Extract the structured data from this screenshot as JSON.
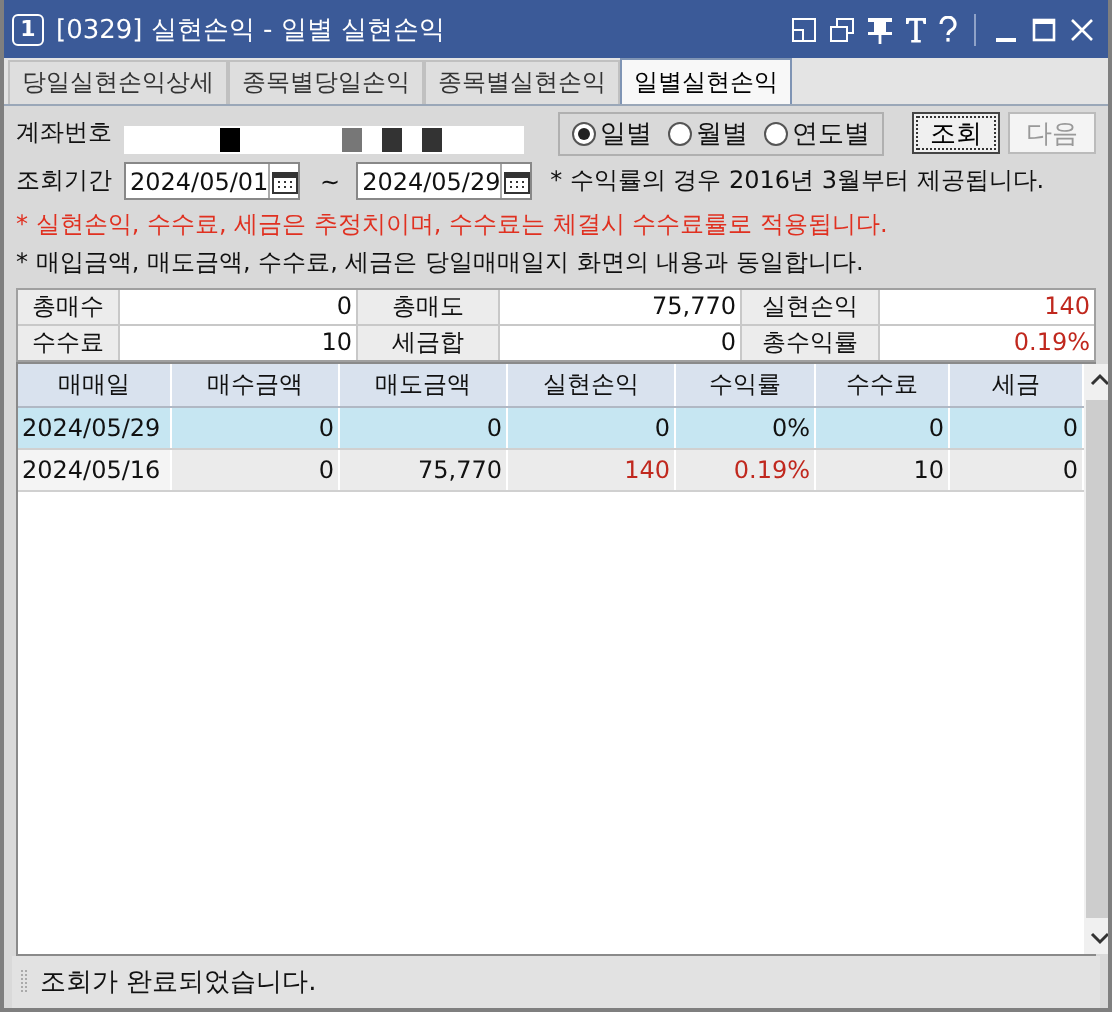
{
  "window": {
    "number": "1",
    "title": "[0329] 실현손익 - 일별 실현손익"
  },
  "tabs": [
    {
      "label": "당일실현손익상세",
      "selected": false
    },
    {
      "label": "종목별당일손익",
      "selected": false
    },
    {
      "label": "종목별실현손익",
      "selected": false
    },
    {
      "label": "일별실현손익",
      "selected": true
    }
  ],
  "account": {
    "label": "계좌번호"
  },
  "periods": [
    {
      "label": "일별",
      "selected": true
    },
    {
      "label": "월별",
      "selected": false
    },
    {
      "label": "연도별",
      "selected": false
    }
  ],
  "buttons": [
    {
      "label": "조회",
      "disabled": false
    },
    {
      "label": "다음",
      "disabled": true
    }
  ],
  "range": {
    "label": "조회기간",
    "from": "2024/05/01",
    "separator": "~",
    "to": "2024/05/29",
    "note": "* 수익률의 경우 2016년 3월부터 제공됩니다."
  },
  "notices": [
    {
      "text": "* 실현손익, 수수료, 세금은 추정치이며, 수수료는 체결시 수수료률로 적용됩니다.",
      "warning": true
    },
    {
      "text": "* 매입금액, 매도금액, 수수료, 세금은 당일매매일지 화면의 내용과 동일합니다.",
      "warning": false
    }
  ],
  "summary": [
    [
      {
        "label": "총매수",
        "value": "0",
        "up": false
      },
      {
        "label": "총매도",
        "value": "75,770",
        "up": false
      },
      {
        "label": "실현손익",
        "value": "140",
        "up": true
      }
    ],
    [
      {
        "label": "수수료",
        "value": "10",
        "up": false
      },
      {
        "label": "세금합",
        "value": "0",
        "up": false
      },
      {
        "label": "총수익률",
        "value": "0.19%",
        "up": true
      }
    ]
  ],
  "table": {
    "columns": [
      "매매일",
      "매수금액",
      "매도금액",
      "실현손익",
      "수익률",
      "수수료",
      "세금"
    ],
    "rows": [
      {
        "selected": true,
        "up": false,
        "cells": [
          "2024/05/29",
          "0",
          "0",
          "0",
          "0%",
          "0",
          "0"
        ]
      },
      {
        "selected": false,
        "up": true,
        "cells": [
          "2024/05/16",
          "0",
          "75,770",
          "140",
          "0.19%",
          "10",
          "0"
        ]
      }
    ]
  },
  "status_bar": "조회가 완료되었습니다."
}
